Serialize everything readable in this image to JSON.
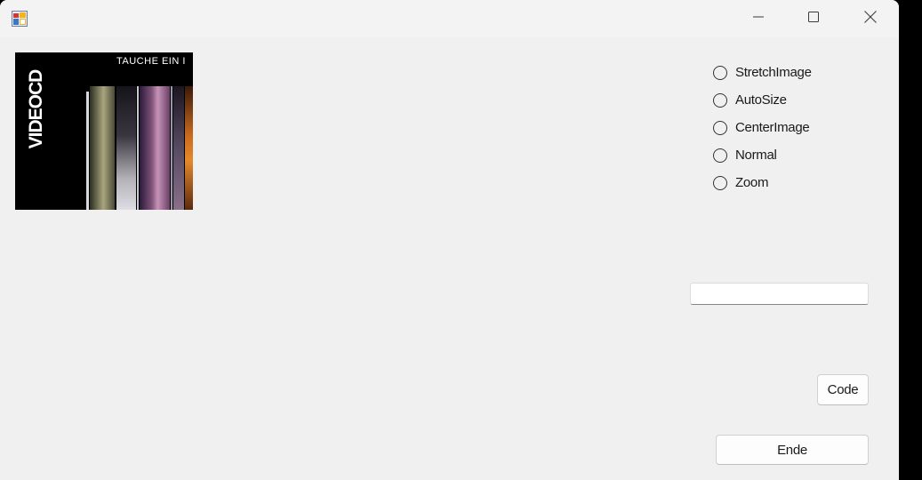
{
  "window": {
    "title": "",
    "icon": "app-form-icon",
    "controls": {
      "minimize_icon": "minimize-icon",
      "maximize_icon": "maximize-icon",
      "close_icon": "close-icon"
    }
  },
  "picture": {
    "logo_text": "VIDEOCD",
    "caption_text": "TAUCHE EIN I"
  },
  "radio_options": [
    {
      "label": "StretchImage",
      "selected": false
    },
    {
      "label": "AutoSize",
      "selected": false
    },
    {
      "label": "CenterImage",
      "selected": false
    },
    {
      "label": "Normal",
      "selected": false
    },
    {
      "label": "Zoom",
      "selected": false
    }
  ],
  "text_field": {
    "value": "",
    "placeholder": ""
  },
  "buttons": {
    "code_label": "Code",
    "ende_label": "Ende"
  },
  "colors": {
    "window_bg": "#f0f0f0",
    "titlebar_bg": "#f3f3f3",
    "outside_bg": "#000000"
  }
}
